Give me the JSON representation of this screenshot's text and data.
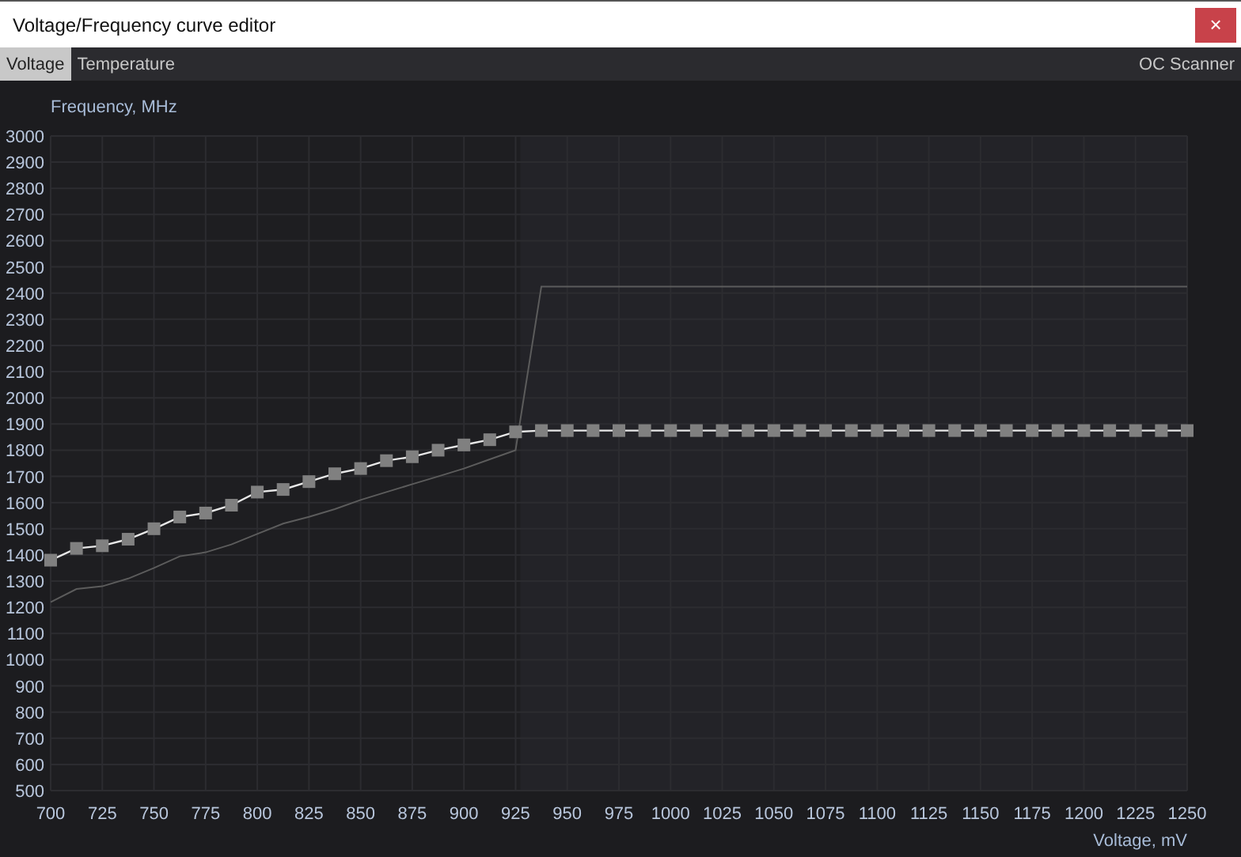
{
  "window": {
    "title": "Voltage/Frequency curve editor",
    "close": "×"
  },
  "tabs": [
    {
      "label": "Voltage",
      "selected": true
    },
    {
      "label": "Temperature",
      "selected": false
    }
  ],
  "oc_scanner": "OC Scanner",
  "chart_data": {
    "type": "line",
    "ylabel": "Frequency, MHz",
    "xlabel": "Voltage, mV",
    "x": [
      700,
      712.5,
      725,
      737.5,
      750,
      762.5,
      775,
      787.5,
      800,
      812.5,
      825,
      837.5,
      850,
      862.5,
      875,
      887.5,
      900,
      912.5,
      925,
      937.5,
      950,
      962.5,
      975,
      987.5,
      1000,
      1012.5,
      1025,
      1037.5,
      1050,
      1062.5,
      1075,
      1087.5,
      1100,
      1112.5,
      1125,
      1137.5,
      1150,
      1162.5,
      1175,
      1187.5,
      1200,
      1212.5,
      1225,
      1237.5,
      1250
    ],
    "series": [
      {
        "color": "#808080",
        "marker": "square",
        "values": [
          1380,
          1425,
          1435,
          1460,
          1500,
          1545,
          1560,
          1590,
          1640,
          1650,
          1680,
          1710,
          1730,
          1760,
          1775,
          1800,
          1820,
          1840,
          1870,
          1875,
          1875,
          1875,
          1875,
          1875,
          1875,
          1875,
          1875,
          1875,
          1875,
          1875,
          1875,
          1875,
          1875,
          1875,
          1875,
          1875,
          1875,
          1875,
          1875,
          1875,
          1875,
          1875,
          1875,
          1875,
          1875
        ]
      },
      {
        "color": "#5c5c5c",
        "values": [
          1220,
          1270,
          1280,
          1310,
          1350,
          1395,
          1410,
          1440,
          1480,
          1520,
          1545,
          1575,
          1610,
          1640,
          1670,
          1700,
          1730,
          1765,
          1800,
          2425,
          2425,
          2425,
          2425,
          2425,
          2425,
          2425,
          2425,
          2425,
          2425,
          2425,
          2425,
          2425,
          2425,
          2425,
          2425,
          2425,
          2425,
          2425,
          2425,
          2425,
          2425,
          2425,
          2425,
          2425,
          2425
        ]
      }
    ],
    "grid": true,
    "xlim": [
      700,
      1250
    ],
    "ylim": [
      500,
      3000
    ],
    "xticks": [
      700,
      725,
      750,
      775,
      800,
      825,
      850,
      875,
      900,
      925,
      950,
      975,
      1000,
      1025,
      1050,
      1075,
      1100,
      1125,
      1150,
      1175,
      1200,
      1225,
      1250
    ],
    "yticks": [
      500,
      600,
      700,
      800,
      900,
      1000,
      1100,
      1200,
      1300,
      1400,
      1500,
      1600,
      1700,
      1800,
      1900,
      2000,
      2100,
      2200,
      2300,
      2400,
      2500,
      2600,
      2700,
      2800,
      2900,
      3000
    ]
  }
}
